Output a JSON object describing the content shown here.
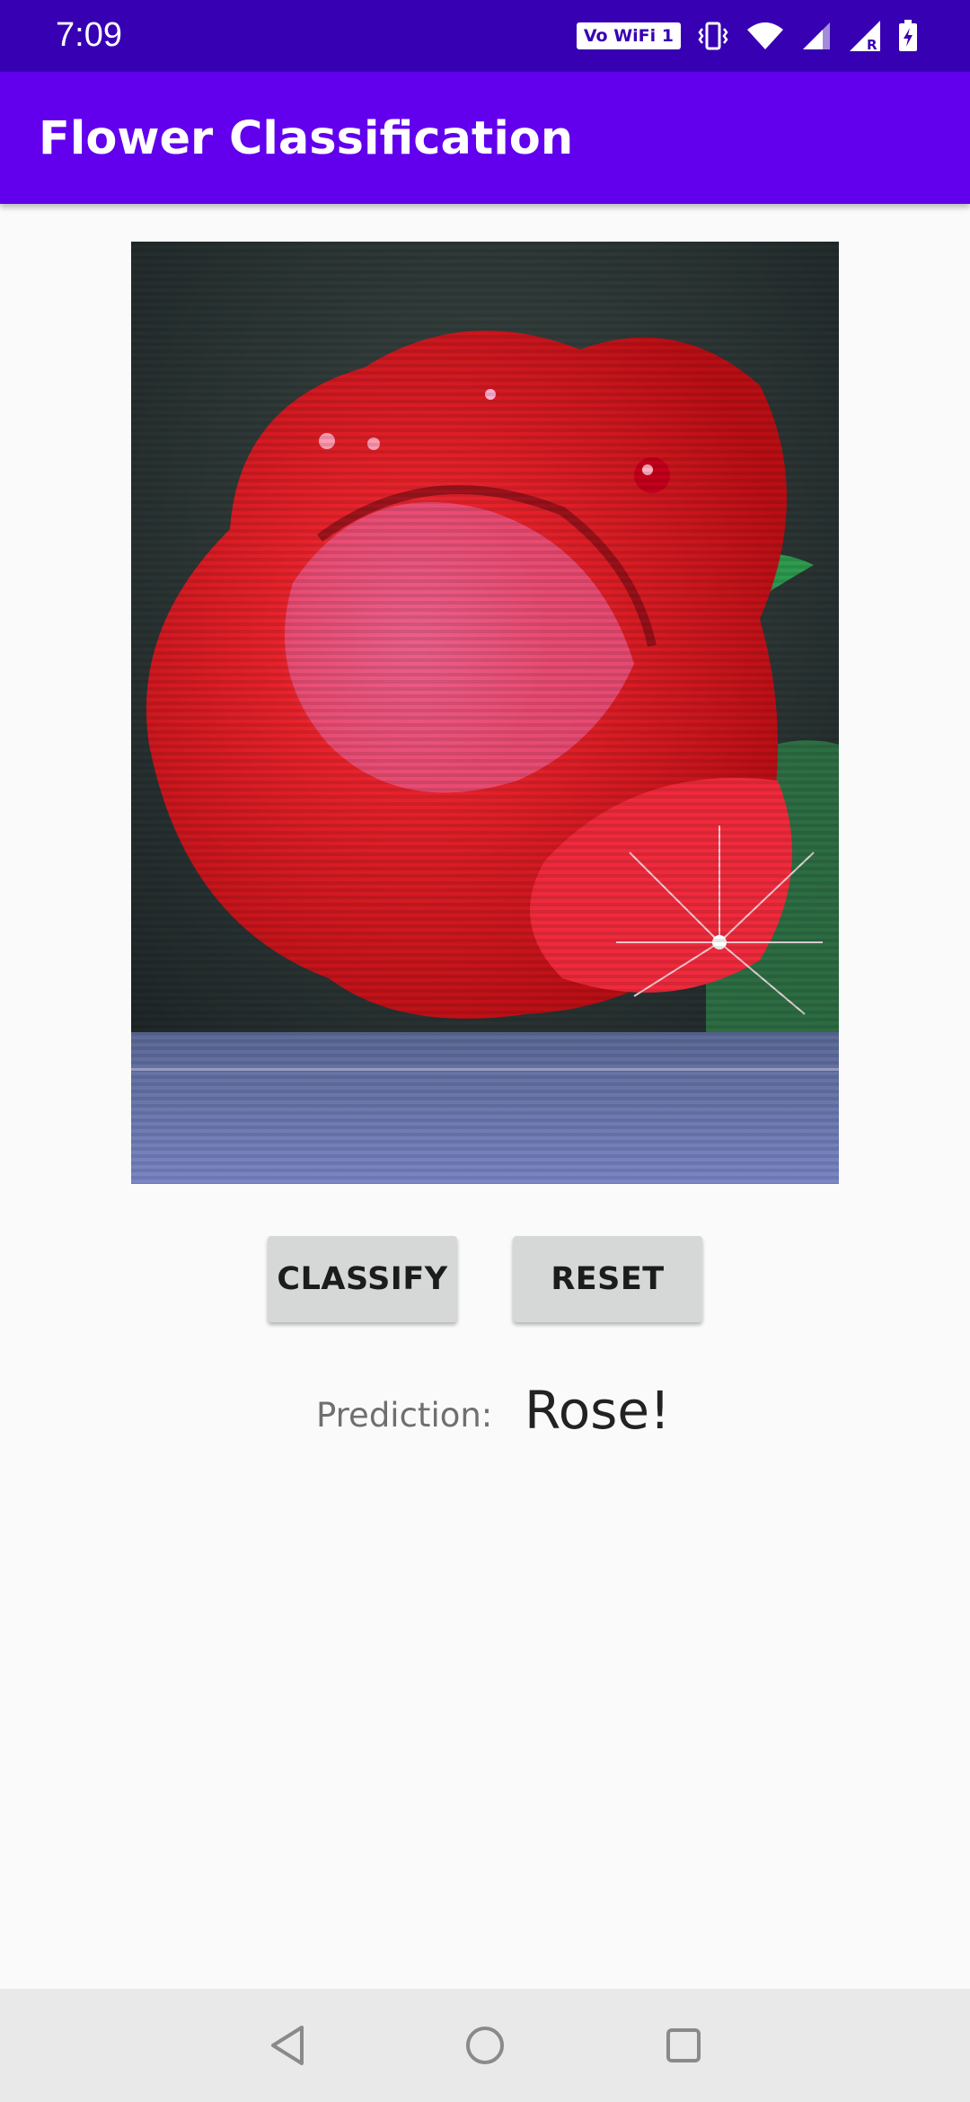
{
  "status_bar": {
    "time": "7:09",
    "wifi_badge": "Vo WiFi 1",
    "icons": [
      "vowifi-icon",
      "vibrate-icon",
      "wifi-icon",
      "signal-icon",
      "signal-roaming-icon",
      "battery-charging-icon"
    ]
  },
  "app_bar": {
    "title": "Flower Classification"
  },
  "image": {
    "subject": "rose",
    "icon": "flower-photo"
  },
  "buttons": {
    "classify": "CLASSIFY",
    "reset": "RESET"
  },
  "prediction": {
    "label": "Prediction:",
    "value": "Rose!"
  },
  "navigation": {
    "icons": [
      "back-icon",
      "home-icon",
      "recents-icon"
    ]
  },
  "colors": {
    "status_bar": "#3700b3",
    "app_bar": "#6200ee",
    "button": "#d6d7d7",
    "background": "#fafafa",
    "nav_bar": "#e9e9e9"
  }
}
